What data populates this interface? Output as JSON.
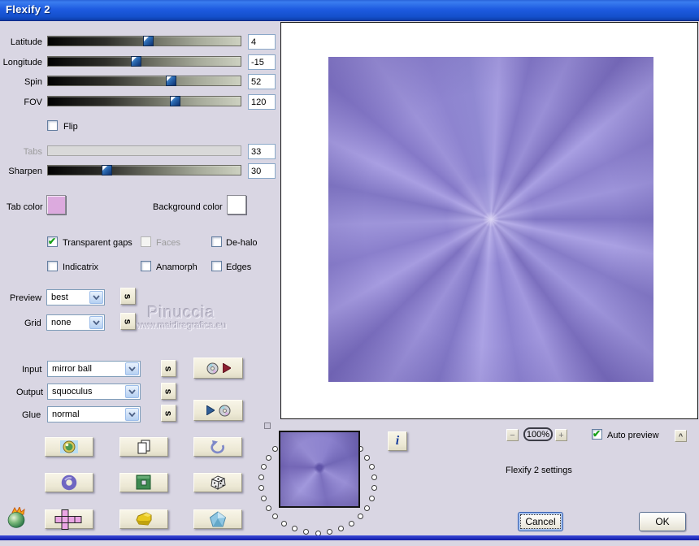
{
  "window": {
    "title": "Flexify 2"
  },
  "sliders": [
    {
      "label": "Latitude",
      "value": "4",
      "percent": 51.9
    },
    {
      "label": "Longitude",
      "value": "-15",
      "percent": 45.6
    },
    {
      "label": "Spin",
      "value": "52",
      "percent": 63.6
    },
    {
      "label": "FOV",
      "value": "120",
      "percent": 65.9
    }
  ],
  "flip": {
    "label": "Flip",
    "checked": false
  },
  "tabs": {
    "label": "Tabs",
    "value": "33",
    "disabled": true
  },
  "sharpen": {
    "label": "Sharpen",
    "value": "30",
    "percent": 30.5
  },
  "tab_color": {
    "label": "Tab color",
    "color": "#dcaade"
  },
  "background_color": {
    "label": "Background color",
    "color": "#ffffff"
  },
  "checkboxes": {
    "transparent_gaps": {
      "label": "Transparent gaps",
      "checked": true,
      "disabled": false
    },
    "faces": {
      "label": "Faces",
      "checked": false,
      "disabled": true
    },
    "dehalo": {
      "label": "De-halo",
      "checked": false,
      "disabled": false
    },
    "indicatrix": {
      "label": "Indicatrix",
      "checked": false,
      "disabled": false
    },
    "anamorph": {
      "label": "Anamorph",
      "checked": false,
      "disabled": false
    },
    "edges": {
      "label": "Edges",
      "checked": false,
      "disabled": false
    }
  },
  "preview_select": {
    "label": "Preview",
    "value": "best"
  },
  "grid_select": {
    "label": "Grid",
    "value": "none"
  },
  "watermark": {
    "line1": "Pinuccia",
    "line2": "www.maidiregrafica.eu"
  },
  "io": {
    "input": {
      "label": "Input",
      "value": "mirror ball"
    },
    "output": {
      "label": "Output",
      "value": "squoculus"
    },
    "glue": {
      "label": "Glue",
      "value": "normal"
    }
  },
  "s_button_label": "s",
  "info_button_label": "i",
  "zoom_controls": {
    "minus": "−",
    "level": "100%",
    "plus": "+",
    "collapse": "^"
  },
  "auto_preview": {
    "label": "Auto preview",
    "checked": true
  },
  "settings_caption": "Flexify 2 settings",
  "actions": {
    "cancel": "Cancel",
    "ok": "OK"
  },
  "memory_ring": {
    "dots_count": 23
  },
  "icons": {
    "globe-icon": "fisheye globe",
    "copy-icon": "duplicate pages",
    "undo-icon": "curved undo arrow",
    "torus-icon": "purple donut",
    "chip-icon": "green square frame",
    "dice-icon": "random dice",
    "cube-net-icon": "pink unfolded cube cross",
    "yellow-solid-icon": "yellow 3d chunk",
    "pentagon-icon": "blue pentagon gem",
    "disc-export-icon": "disc with red play triangle",
    "disc-import-icon": "blue play triangle with disc",
    "pear-logo": "flaming pear logo"
  },
  "palette": {
    "dialog_bg": "#d9d6e3",
    "titlebar_blue": "#1e5be0",
    "preview_purple_mid": "#8d83cf",
    "preview_purple_light": "#a79ede",
    "preview_purple_dark": "#7d71c2",
    "button_face": "#efecdb",
    "bottom_strip_blue": "#1c2cc0"
  }
}
